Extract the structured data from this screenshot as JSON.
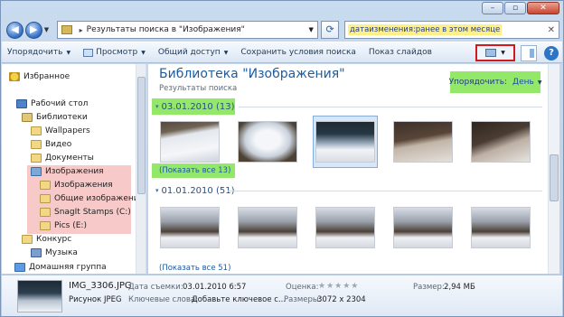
{
  "window": {
    "minimize_label": "–",
    "maximize_label": "▫",
    "close_label": "✕"
  },
  "address": {
    "back_glyph": "◀",
    "forward_glyph": "▶",
    "dropdown_glyph": "▼",
    "separator": "▸",
    "breadcrumb": "Результаты поиска в \"Изображения\"",
    "refresh_glyph": "⟳"
  },
  "search": {
    "query": "датаизменения:ранее в этом месяце",
    "clear_glyph": "✕"
  },
  "toolbar": {
    "organize": "Упорядочить",
    "preview": "Просмотр",
    "share": "Общий доступ",
    "save_search": "Сохранить условия поиска",
    "slideshow": "Показ слайдов",
    "arrow": "▼",
    "help_label": "?"
  },
  "nav": {
    "favorites": "Избранное",
    "desktop": "Рабочий стол",
    "libraries": "Библиотеки",
    "wallpapers": "Wallpapers",
    "video": "Видео",
    "documents": "Документы",
    "images": "Изображения",
    "images_sub": "Изображения",
    "public_images": "Общие изображения",
    "snagit": "SnagIt Stamps (C:)",
    "pics": "Pics (E:)",
    "contest": "Конкурс",
    "music": "Музыка",
    "homegroup": "Домашняя группа"
  },
  "content": {
    "title": "Библиотека \"Изображения\"",
    "subtitle": "Результаты поиска",
    "arrange_label": "Упорядочить:",
    "arrange_value": "День",
    "groups": [
      {
        "header": "03.01.2010 (13)",
        "show_all": "(Показать все 13)"
      },
      {
        "header": "01.01.2010 (51)",
        "show_all": "(Показать все 51)"
      }
    ]
  },
  "details": {
    "filename": "IMG_3306.JPG",
    "filetype": "Рисунок JPEG",
    "date_taken_label": "Дата съемки:",
    "date_taken": "03.01.2010 6:57",
    "tags_label": "Ключевые слова:",
    "tags_value": "Добавьте ключевое с...",
    "rating_label": "Оценка:",
    "rating_stars": "★★★★★",
    "dimensions_label": "Размеры:",
    "dimensions": "3072 x 2304",
    "size_label": "Размер:",
    "size": "2,94 МБ"
  },
  "colors": {
    "green_highlight": "#93e86a",
    "red_highlight": "#f7c9c9",
    "view_button_border": "#d31a1a",
    "search_highlight": "#ffef86"
  }
}
